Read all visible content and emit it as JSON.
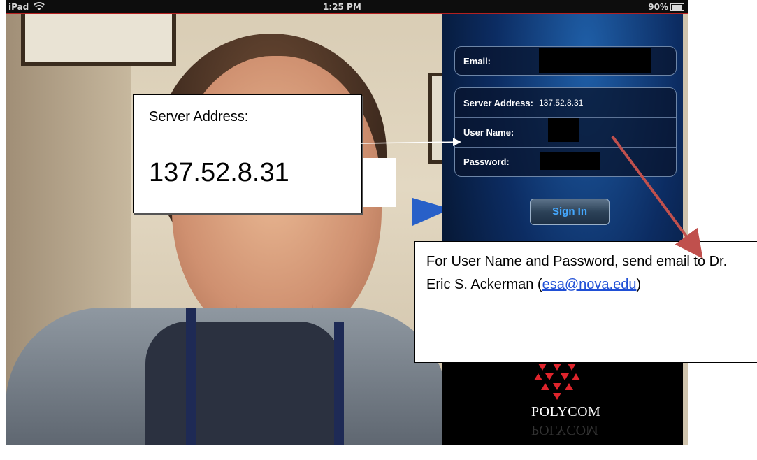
{
  "status_bar": {
    "carrier": "iPad",
    "time": "1:25 PM",
    "battery": "90%",
    "wifi_icon": "wifi-icon",
    "battery_icon": "battery-icon"
  },
  "login_form": {
    "email_label": "Email:",
    "server_label": "Server Address:",
    "server_value": "137.52.8.31",
    "username_label": "User Name:",
    "password_label": "Password:",
    "sign_in_label": "Sign In"
  },
  "brand": {
    "name": "POLYCOM",
    "logo_icon": "polycom-logo-icon",
    "logo_color": "#e0242c"
  },
  "callouts": {
    "server": {
      "label": "Server Address:",
      "value": "137.52.8.31"
    },
    "credentials": {
      "text_before": "For User Name and Password, send email to Dr. Eric S. Ackerman (",
      "email_link": "esa@nova.edu",
      "text_after": ")"
    }
  },
  "colors": {
    "arrow": "#c0504d",
    "link": "#1f4fd6",
    "sign_in_text": "#44a8ff"
  }
}
